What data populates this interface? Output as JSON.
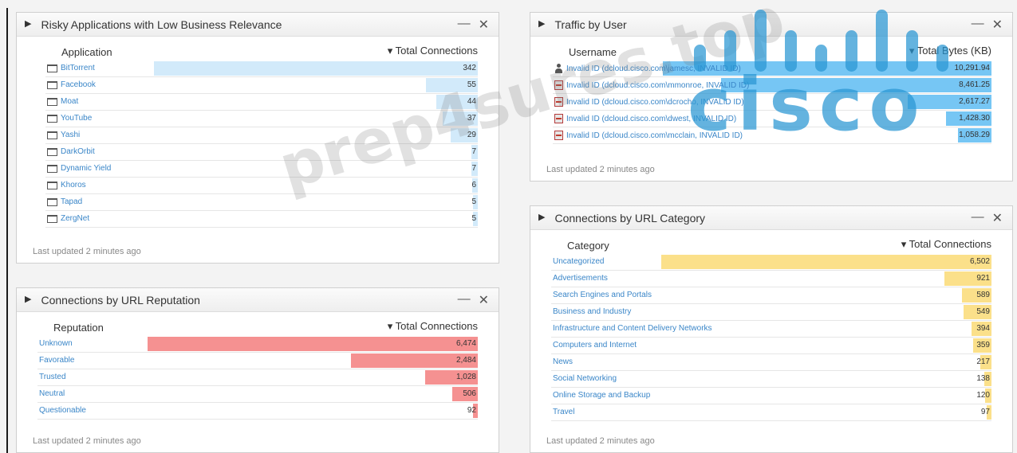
{
  "colors": {
    "app_bar": "#d2eafa",
    "user_bar": "#76c6f4",
    "reputation_bar": "#f59191",
    "category_bar": "#fbe08a",
    "link": "#3a86c8"
  },
  "watermark": {
    "brand": "cisco",
    "site": "prep4sures.top"
  },
  "widgets": {
    "risky_apps": {
      "title": "Risky Applications with Low Business Relevance",
      "col1": "Application",
      "col2": "▾ Total Connections",
      "footer": "Last updated 2 minutes ago",
      "max": 342,
      "rows": [
        {
          "label": "BitTorrent",
          "value": "342",
          "n": 342
        },
        {
          "label": "Facebook",
          "value": "55",
          "n": 55
        },
        {
          "label": "Moat",
          "value": "44",
          "n": 44
        },
        {
          "label": "YouTube",
          "value": "37",
          "n": 37
        },
        {
          "label": "Yashi",
          "value": "29",
          "n": 29
        },
        {
          "label": "DarkOrbit",
          "value": "7",
          "n": 7
        },
        {
          "label": "Dynamic Yield",
          "value": "7",
          "n": 7
        },
        {
          "label": "Khoros",
          "value": "6",
          "n": 6
        },
        {
          "label": "Tapad",
          "value": "5",
          "n": 5
        },
        {
          "label": "ZergNet",
          "value": "5",
          "n": 5
        }
      ]
    },
    "url_reputation": {
      "title": "Connections by URL Reputation",
      "col1": "Reputation",
      "col2": "▾ Total Connections",
      "footer": "Last updated 2 minutes ago",
      "max": 6474,
      "rows": [
        {
          "label": "Unknown",
          "value": "6,474",
          "n": 6474
        },
        {
          "label": "Favorable",
          "value": "2,484",
          "n": 2484
        },
        {
          "label": "Trusted",
          "value": "1,028",
          "n": 1028
        },
        {
          "label": "Neutral",
          "value": "506",
          "n": 506
        },
        {
          "label": "Questionable",
          "value": "92",
          "n": 92
        }
      ]
    },
    "traffic_by_user": {
      "title": "Traffic by User",
      "col1": "Username",
      "col2": "▾ Total Bytes (KB)",
      "footer": "Last updated 2 minutes ago",
      "max": 10291.94,
      "rows": [
        {
          "label": "Invalid ID (dcloud.cisco.com\\jamesc, INVALID ID)",
          "value": "10,291.94",
          "n": 10291.94,
          "icon": "person"
        },
        {
          "label": "Invalid ID (dcloud.cisco.com\\mmonroe, INVALID ID)",
          "value": "8,461.25",
          "n": 8461.25,
          "icon": "invalid"
        },
        {
          "label": "Invalid ID (dcloud.cisco.com\\dcrocho, INVALID ID)",
          "value": "2,617.27",
          "n": 2617.27,
          "icon": "invalid"
        },
        {
          "label": "Invalid ID (dcloud.cisco.com\\dwest, INVALID ID)",
          "value": "1,428.30",
          "n": 1428.3,
          "icon": "invalid"
        },
        {
          "label": "Invalid ID (dcloud.cisco.com\\mcclain, INVALID ID)",
          "value": "1,058.29",
          "n": 1058.29,
          "icon": "invalid"
        }
      ]
    },
    "url_category": {
      "title": "Connections by URL Category",
      "col1": "Category",
      "col2": "▾ Total Connections",
      "footer": "Last updated 2 minutes ago",
      "max": 6502,
      "rows": [
        {
          "label": "Uncategorized",
          "value": "6,502",
          "n": 6502
        },
        {
          "label": "Advertisements",
          "value": "921",
          "n": 921
        },
        {
          "label": "Search Engines and Portals",
          "value": "589",
          "n": 589
        },
        {
          "label": "Business and Industry",
          "value": "549",
          "n": 549
        },
        {
          "label": "Infrastructure and Content Delivery Networks",
          "value": "394",
          "n": 394
        },
        {
          "label": "Computers and Internet",
          "value": "359",
          "n": 359
        },
        {
          "label": "News",
          "value": "217",
          "n": 217
        },
        {
          "label": "Social Networking",
          "value": "138",
          "n": 138
        },
        {
          "label": "Online Storage and Backup",
          "value": "120",
          "n": 120
        },
        {
          "label": "Travel",
          "value": "97",
          "n": 97
        }
      ]
    }
  }
}
